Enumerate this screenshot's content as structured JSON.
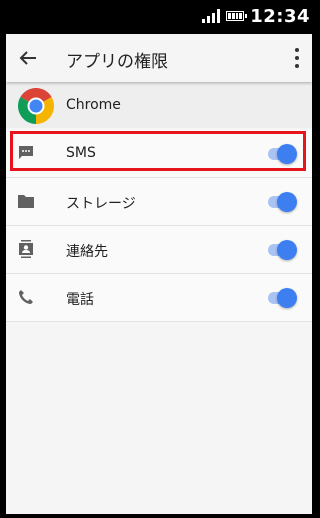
{
  "status_bar": {
    "time": "12:34",
    "signal_icon": "signal-icon",
    "battery_icon": "battery-icon"
  },
  "toolbar": {
    "title": "アプリの権限",
    "back_icon": "arrow-back-icon",
    "more_icon": "more-vert-icon"
  },
  "app": {
    "name": "Chrome",
    "icon": "chrome-logo-icon"
  },
  "colors": {
    "highlight": "#e8141d",
    "toggle_on": "#3d7ff0",
    "toggle_track": "#a9c3f3"
  },
  "permissions": [
    {
      "label": "SMS",
      "icon": "message-icon",
      "enabled": true,
      "highlighted": true
    },
    {
      "label": "ストレージ",
      "icon": "folder-icon",
      "enabled": true,
      "highlighted": false
    },
    {
      "label": "連絡先",
      "icon": "contacts-icon",
      "enabled": true,
      "highlighted": false
    },
    {
      "label": "電話",
      "icon": "phone-icon",
      "enabled": true,
      "highlighted": false
    }
  ]
}
